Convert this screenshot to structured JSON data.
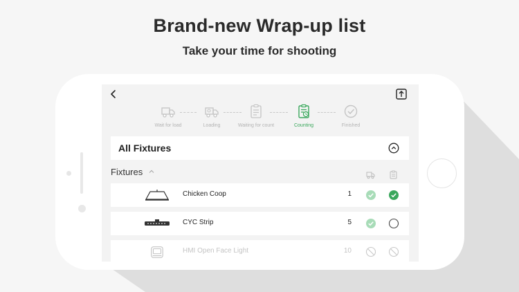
{
  "headline": "Brand-new Wrap-up list",
  "subheadline": "Take your time for shooting",
  "colors": {
    "accent": "#3aa75c",
    "accent_light": "#a8dcb8",
    "muted": "#c8c8c8"
  },
  "steps": [
    {
      "label": "Wait for load",
      "icon": "truck-icon",
      "active": false
    },
    {
      "label": "Loading",
      "icon": "truck-loading-icon",
      "active": false
    },
    {
      "label": "Waiting for count",
      "icon": "clipboard-icon",
      "active": false
    },
    {
      "label": "Counting",
      "icon": "clipboard-clock-icon",
      "active": true
    },
    {
      "label": "Finished",
      "icon": "check-circle-icon",
      "active": false
    }
  ],
  "all_fixtures": {
    "title": "All Fixtures"
  },
  "section": {
    "title": "Fixtures"
  },
  "rows": [
    {
      "name": "Chicken Coop",
      "qty": "1",
      "loaded": "checked-light",
      "counted": "checked",
      "dimmed": false
    },
    {
      "name": "CYC Strip",
      "qty": "5",
      "loaded": "checked-light",
      "counted": "empty",
      "dimmed": false
    },
    {
      "name": "HMI Open Face Light",
      "qty": "10",
      "loaded": "disabled",
      "counted": "disabled",
      "dimmed": true
    }
  ]
}
